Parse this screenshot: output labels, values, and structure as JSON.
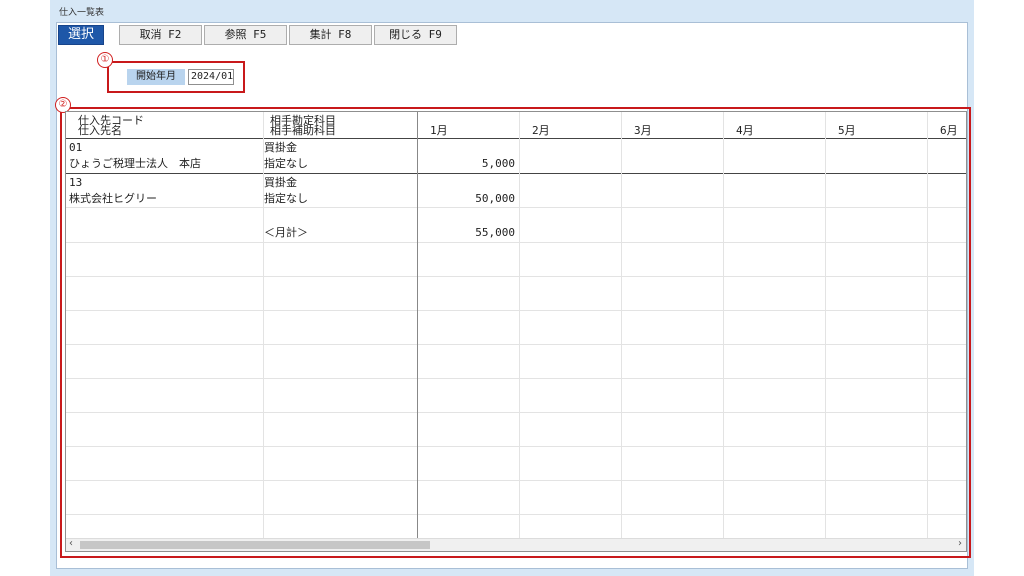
{
  "window": {
    "title": "仕入一覧表"
  },
  "toolbar": {
    "select_label": "選択",
    "buttons": [
      "取消 F2",
      "参照 F5",
      "集計 F8",
      "閉じる F9"
    ]
  },
  "callouts": {
    "one": "①",
    "two": "②"
  },
  "filters": {
    "start_label": "開始年月",
    "start_value": "2024/01"
  },
  "grid": {
    "col1_header": [
      "仕入先コード",
      "仕入先名"
    ],
    "col2_header": [
      "相手勘定科目",
      "相手補助科目"
    ],
    "months": [
      "1月",
      "2月",
      "3月",
      "4月",
      "5月",
      "6月"
    ],
    "rows": [
      {
        "code": "01",
        "name": "ひょうご税理士法人　本店",
        "account": "買掛金",
        "sub": "指定なし",
        "m1": "5,000"
      },
      {
        "code": "13",
        "name": "株式会社ヒグリー",
        "account": "買掛金",
        "sub": "指定なし",
        "m1": "50,000"
      }
    ],
    "total_label": "＜月計＞",
    "total_m1": "55,000"
  },
  "scroll": {
    "left": "‹",
    "right": "›"
  }
}
